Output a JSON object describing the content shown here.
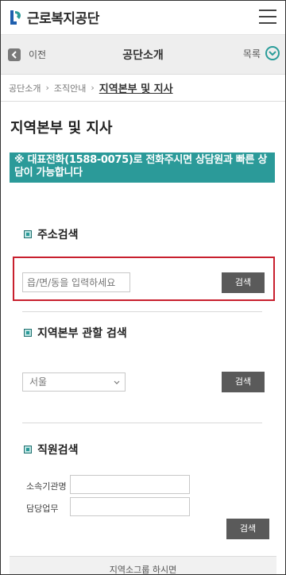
{
  "header": {
    "logo_text": "근로복지공단"
  },
  "subbar": {
    "back_label": "이전",
    "title": "공단소개",
    "list_label": "목록"
  },
  "breadcrumb": {
    "items": [
      "공단소개",
      "조직안내"
    ],
    "current": "지역본부 및 지사"
  },
  "page": {
    "title": "지역본부 및 지사",
    "notice": "※ 대표전화(1588-0075)로 전화주시면 상담원과 빠른 상담이 가능합니다"
  },
  "address_search": {
    "title": "주소검색",
    "placeholder": "읍/면/동을 입력하세요",
    "button": "검색"
  },
  "region_search": {
    "title": "지역본부 관할 검색",
    "selected": "서울",
    "button": "검색"
  },
  "staff_search": {
    "title": "직원검색",
    "org_label": "소속기관명",
    "duty_label": "담당업무",
    "button": "검색"
  },
  "footer_hint": "지역소그룹 하시면",
  "colors": {
    "accent": "#2b9a99",
    "highlight": "#c8202e",
    "button": "#5a5a5a"
  }
}
